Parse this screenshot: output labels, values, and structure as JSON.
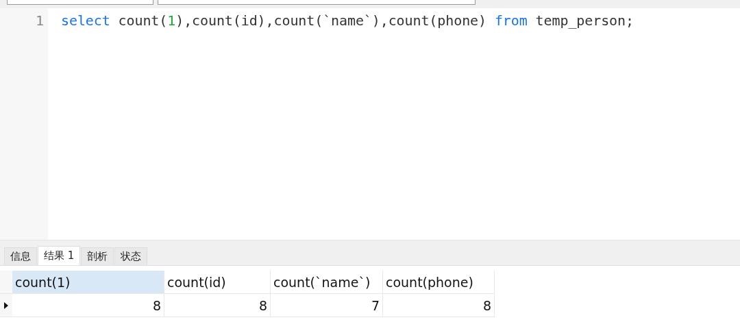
{
  "editor": {
    "lines": [
      {
        "number": "1",
        "tokens": [
          {
            "kind": "keyword",
            "text": "select"
          },
          {
            "kind": "plain",
            "text": " count("
          },
          {
            "kind": "number",
            "text": "1"
          },
          {
            "kind": "plain",
            "text": "),count(id),count(`name`),count(phone) "
          },
          {
            "kind": "keyword",
            "text": "from"
          },
          {
            "kind": "plain",
            "text": " temp_person;"
          }
        ]
      }
    ]
  },
  "result_tabs": [
    {
      "label": "信息",
      "selected": false
    },
    {
      "label": "结果 1",
      "selected": true
    },
    {
      "label": "剖析",
      "selected": false
    },
    {
      "label": "状态",
      "selected": false
    }
  ],
  "table": {
    "columns": [
      {
        "label": "count(1)",
        "selected": true
      },
      {
        "label": "count(id)",
        "selected": false
      },
      {
        "label": "count(`name`)",
        "selected": false
      },
      {
        "label": "count(phone)",
        "selected": false
      }
    ],
    "rows": [
      {
        "current": true,
        "cells": [
          "8",
          "8",
          "7",
          "8"
        ]
      }
    ]
  }
}
